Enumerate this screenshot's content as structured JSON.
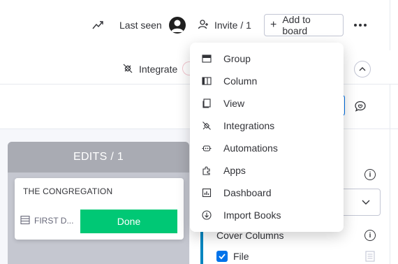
{
  "header": {
    "last_seen_label": "Last seen",
    "invite_label": "Invite / 1",
    "add_to_board_label": "Add to board"
  },
  "toolbar": {
    "integrate_label": "Integrate"
  },
  "menu": {
    "items": [
      {
        "label": "Group",
        "icon": "group-icon"
      },
      {
        "label": "Column",
        "icon": "column-icon"
      },
      {
        "label": "View",
        "icon": "view-icon"
      },
      {
        "label": "Integrations",
        "icon": "integrations-icon"
      },
      {
        "label": "Automations",
        "icon": "automations-icon"
      },
      {
        "label": "Apps",
        "icon": "apps-icon"
      },
      {
        "label": "Dashboard",
        "icon": "dashboard-icon"
      },
      {
        "label": "Import Books",
        "icon": "import-icon"
      }
    ]
  },
  "kanban": {
    "column_title": "EDITS / 1",
    "card": {
      "title": "THE CONGREGATION",
      "field_label": "FIRST D...",
      "status_label": "Done",
      "status_color": "#00c875"
    }
  },
  "settings_panel": {
    "cover_columns_label": "Cover Columns",
    "file_option_label": "File",
    "file_option_checked": true
  }
}
